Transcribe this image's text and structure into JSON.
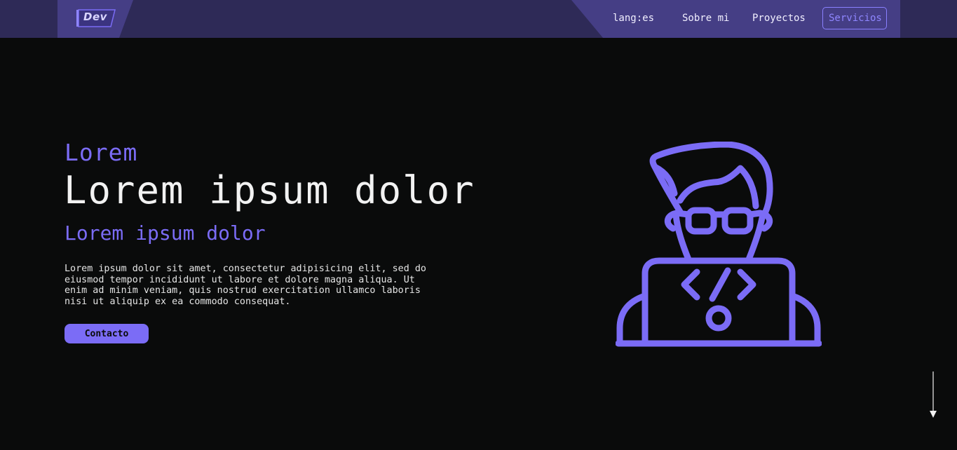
{
  "header": {
    "logo_text": "Dev",
    "nav": [
      {
        "label": "lang:es"
      },
      {
        "label": "Sobre mi"
      },
      {
        "label": "Proyectos"
      },
      {
        "label": "Servicios",
        "active": true
      }
    ]
  },
  "hero": {
    "kicker": "Lorem",
    "headline": "Lorem ipsum dolor",
    "subheadline": "Lorem ipsum dolor",
    "body": "Lorem ipsum dolor sit amet, consectetur adipisicing elit, sed do eiusmod tempor incididunt ut labore et dolore magna aliqua. Ut enim ad minim veniam, quis nostrud exercitation ullamco laboris nisi ut aliquip ex ea commodo consequat.",
    "cta_label": "Contacto"
  },
  "icons": {
    "illustration": "developer-avatar-icon",
    "scroll": "arrow-down-icon"
  },
  "colors": {
    "accent": "#7b6cf6",
    "header_dark": "#2e2a57",
    "header_light": "#453e85",
    "background": "#0a0b0b",
    "text": "#f2f2f2"
  }
}
